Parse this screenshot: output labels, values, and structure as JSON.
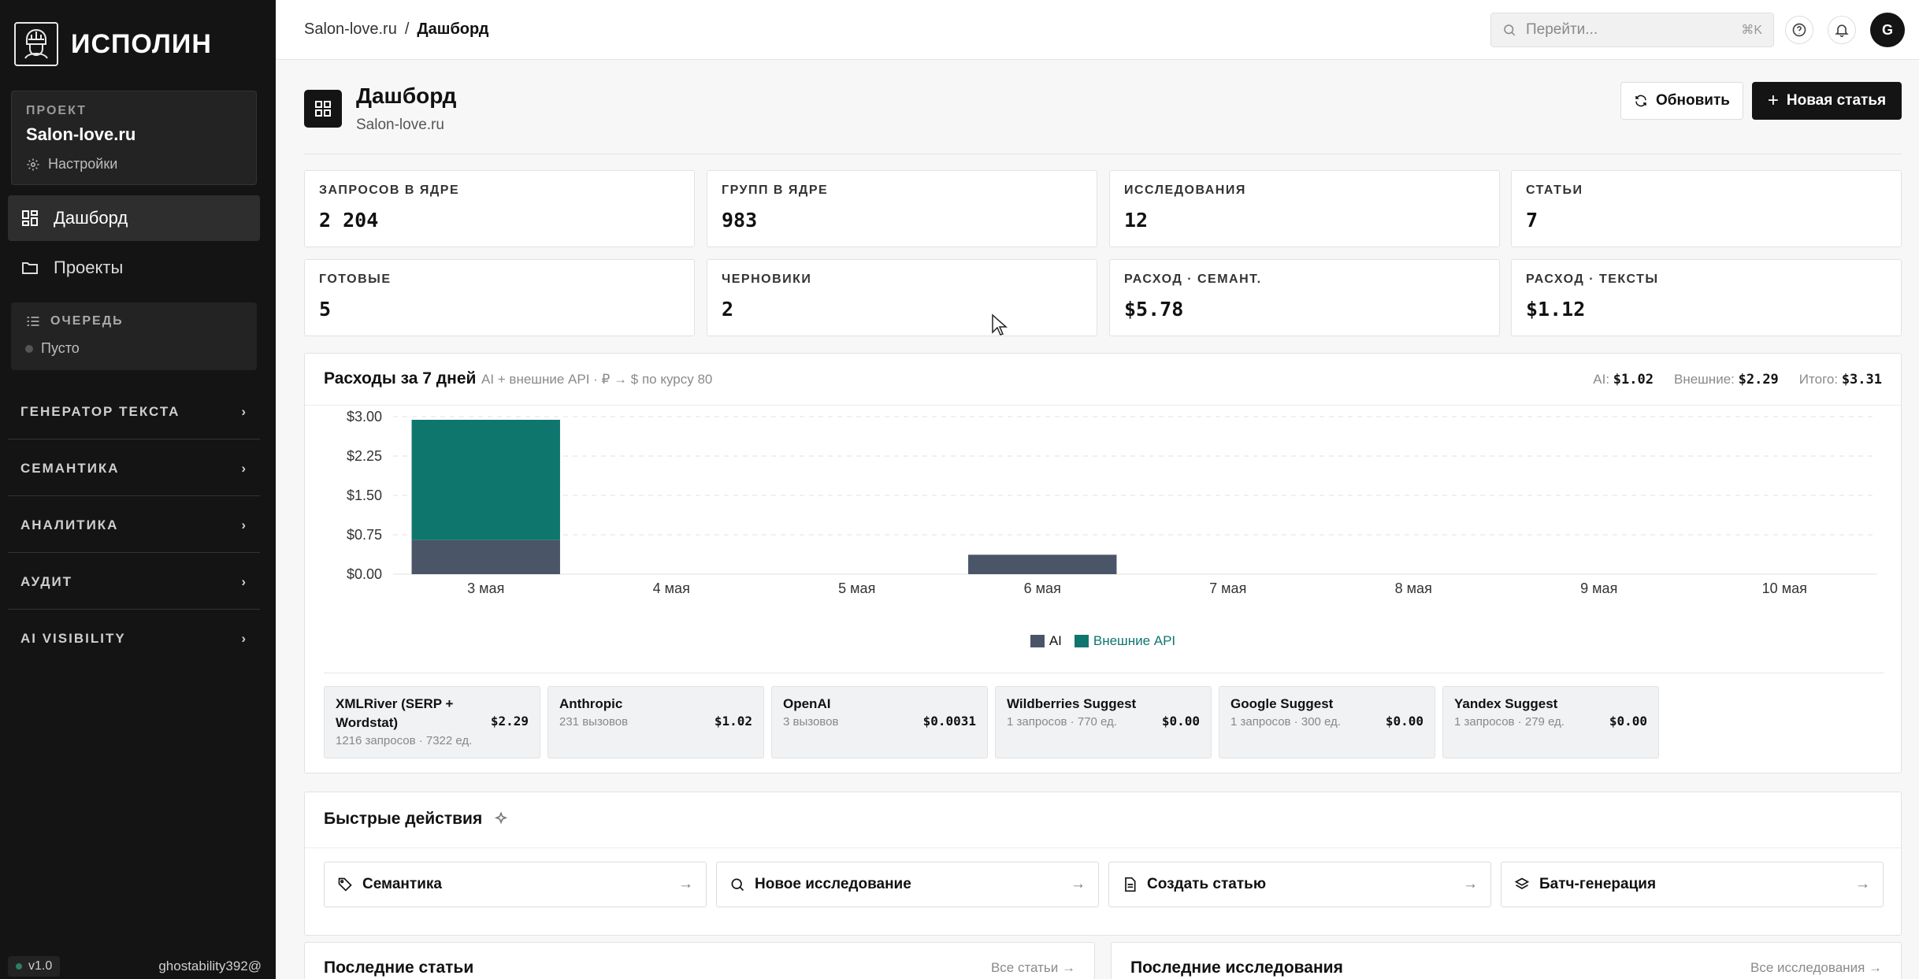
{
  "app": {
    "name": "ИСПОЛИН",
    "version": "v1.0",
    "user": "ghostability392@"
  },
  "sidebar": {
    "project_label": "ПРОЕКТ",
    "project_name": "Salon-love.ru",
    "settings_label": "Настройки",
    "nav": [
      {
        "label": "Дашборд",
        "icon": "grid-icon",
        "active": true
      },
      {
        "label": "Проекты",
        "icon": "folder-icon",
        "active": false
      }
    ],
    "queue": {
      "title": "ОЧЕРЕДЬ",
      "status": "Пусто"
    },
    "sections": [
      "ГЕНЕРАТОР ТЕКСТА",
      "СЕМАНТИКА",
      "АНАЛИТИКА",
      "АУДИТ",
      "AI VISIBILITY"
    ]
  },
  "topbar": {
    "breadcrumb": [
      "Salon-love.ru",
      "/",
      "Дашборд"
    ],
    "search_placeholder": "Перейти...",
    "search_shortcut": "⌘K",
    "avatar_letter": "G"
  },
  "page": {
    "title": "Дашборд",
    "subtitle": "Salon-love.ru",
    "refresh_label": "Обновить",
    "new_article_label": "Новая статья"
  },
  "stats": [
    {
      "label": "ЗАПРОСОВ В ЯДРЕ",
      "value": "2 204"
    },
    {
      "label": "ГРУПП В ЯДРЕ",
      "value": "983"
    },
    {
      "label": "ИССЛЕДОВАНИЯ",
      "value": "12"
    },
    {
      "label": "СТАТЬИ",
      "value": "7"
    },
    {
      "label": "ГОТОВЫЕ",
      "value": "5"
    },
    {
      "label": "ЧЕРНОВИКИ",
      "value": "2"
    },
    {
      "label": "РАСХОД · СЕМАНТ.",
      "value": "$5.78"
    },
    {
      "label": "РАСХОД · ТЕКСТЫ",
      "value": "$1.12"
    }
  ],
  "costs": {
    "title": "Расходы за 7 дней",
    "subtitle": "AI + внешние API · ₽ → $ по курсу 80",
    "totals": {
      "ai_label": "AI:",
      "ai": "$1.02",
      "ext_label": "Внешние:",
      "ext": "$2.29",
      "total_label": "Итого:",
      "total": "$3.31"
    }
  },
  "chart_data": {
    "type": "bar",
    "stacked": true,
    "categories": [
      "3 мая",
      "4 мая",
      "5 мая",
      "6 мая",
      "7 мая",
      "8 мая",
      "9 мая",
      "10 мая"
    ],
    "series": [
      {
        "name": "AI",
        "color": "#4a5568",
        "values": [
          0.65,
          0,
          0,
          0.37,
          0,
          0,
          0,
          0
        ]
      },
      {
        "name": "Внешние API",
        "color": "#0f766e",
        "values": [
          2.29,
          0,
          0,
          0,
          0,
          0,
          0,
          0
        ]
      }
    ],
    "yticks": [
      "$3.00",
      "$2.25",
      "$1.50",
      "$0.75",
      "$0.00"
    ],
    "ylim": [
      0,
      3
    ],
    "grid": true,
    "legend": "bottom-center"
  },
  "providers": [
    {
      "name": "XMLRiver (SERP + Wordstat)",
      "detail": "1216 запросов · 7322 ед.",
      "cost": "$2.29"
    },
    {
      "name": "Anthropic",
      "detail": "231 вызовов",
      "cost": "$1.02"
    },
    {
      "name": "OpenAI",
      "detail": "3 вызовов",
      "cost": "$0.0031"
    },
    {
      "name": "Wildberries Suggest",
      "detail": "1 запросов · 770 ед.",
      "cost": "$0.00"
    },
    {
      "name": "Google Suggest",
      "detail": "1 запросов · 300 ед.",
      "cost": "$0.00"
    },
    {
      "name": "Yandex Suggest",
      "detail": "1 запросов · 279 ед.",
      "cost": "$0.00"
    }
  ],
  "quick_actions": {
    "title": "Быстрые действия",
    "items": [
      {
        "label": "Семантика",
        "icon": "tag-icon"
      },
      {
        "label": "Новое исследование",
        "icon": "search-icon"
      },
      {
        "label": "Создать статью",
        "icon": "document-icon"
      },
      {
        "label": "Батч-генерация",
        "icon": "layers-icon"
      }
    ]
  },
  "recent_articles": {
    "title": "Последние статьи",
    "link": "Все статьи →"
  },
  "recent_research": {
    "title": "Последние исследования",
    "link": "Все исследования →"
  }
}
